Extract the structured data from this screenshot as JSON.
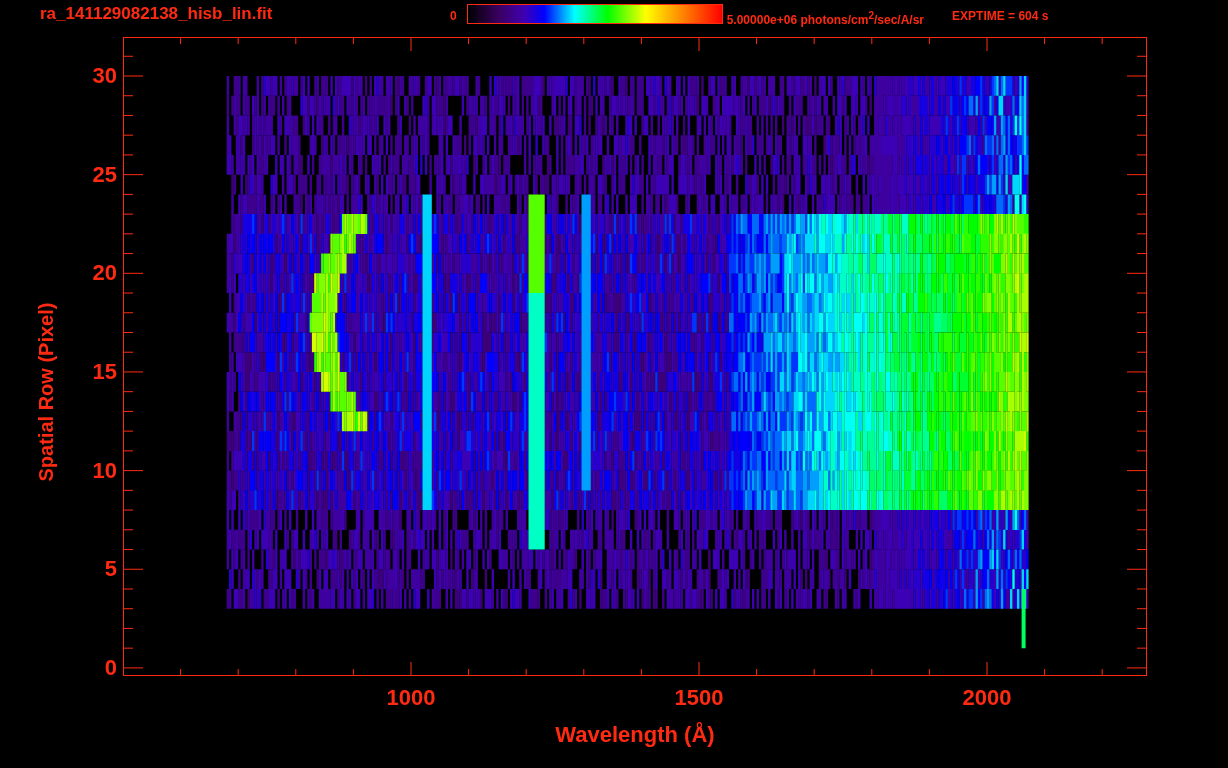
{
  "header": {
    "file_name": "ra_141129082138_hisb_lin.fit",
    "colorbar_min": "0",
    "colorbar_max": "5.00000e+06 photons/cm$^{2}$/sec/A/sr",
    "exposure": "EXPTIME = 604 s"
  },
  "plot": {
    "xlabel": "Wavelength (Å)",
    "ylabel": "Spatial Row (Pixel)",
    "xticks": [
      "1000",
      "1500",
      "2000"
    ],
    "yticks": [
      "30",
      "25",
      "20",
      "15",
      "10",
      "5",
      "0"
    ]
  }
}
